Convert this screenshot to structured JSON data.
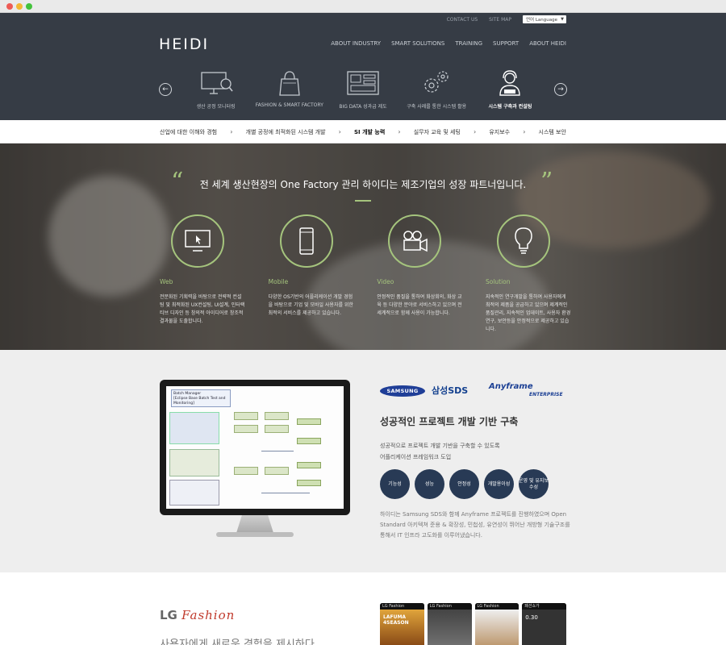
{
  "topbar": {
    "contact": "CONTACT US",
    "sitemap": "SITE MAP",
    "language": "언어 Language"
  },
  "logo": "HEIDI",
  "main_nav": [
    "ABOUT INDUSTRY",
    "SMART SOLUTIONS",
    "TRAINING",
    "SUPPORT",
    "ABOUT HEIDI"
  ],
  "categories": [
    {
      "label": "생산 공정 모니터링",
      "icon": "monitor-magnifier-icon"
    },
    {
      "label": "FASHION & SMART FACTORY",
      "icon": "shopping-bag-icon"
    },
    {
      "label": "BIG DATA 성과급 제도",
      "icon": "dashboard-icon"
    },
    {
      "label": "구축 사례를 통한 시스템 활용",
      "icon": "gears-icon"
    },
    {
      "label": "시스템 구축과 컨설팅",
      "icon": "headset-user-icon"
    }
  ],
  "sub_nav": [
    "산업에 대한 이해와 경험",
    "개별 공정에 최적화된 시스템 개발",
    "SI 개발 능력",
    "실무자 교육 및 세팅",
    "유지보수",
    "시스템 보안"
  ],
  "hero": {
    "quote": "전 세계 생산현장의 One Factory 관리 하이디는 제조기업의 성장 파트너입니다.",
    "open_mark": "“",
    "close_mark": "”",
    "services": [
      {
        "title": "Web",
        "icon": "desktop-cursor-icon",
        "desc": "전문화된 기획력을 바탕으로 전략적 컨설팅 및 최적화된 UX컨설팅, UI설계, 인터랙티브 디자인 등 창의적 아이디어로 창조적 결과물을 도출합니다."
      },
      {
        "title": "Mobile",
        "icon": "smartphone-icon",
        "desc": "다양한 OS기반의 어플리케이션 개발 경험을 바탕으로 기업 및 모바일 사용자를 위한 최적의 서비스를 제공하고 있습니다."
      },
      {
        "title": "Video",
        "icon": "video-camera-icon",
        "desc": "안정적인 품질을 통하여 화상회의, 화상 교육 등 다양한 분야로 서비스하고 있으며 전세계적으로 함께 사용이 가능합니다."
      },
      {
        "title": "Solution",
        "icon": "lightbulb-icon",
        "desc": "지속적인 연구개발을 통하여 사용자에게 최적의 제품을 공급하고 있으며 제계적인 품질관리, 지속적인 업데이트, 사용자 환경 연구, 보안등을 안정적으로 제공하고 있습니다."
      }
    ]
  },
  "samsung": {
    "brand_samsung": "SAMSUNG",
    "brand_sds": "삼성SDS",
    "brand_anyframe": "Anyframe",
    "brand_enterprise": "ENTERPRISE",
    "title": "성공적인 프로젝트 개발 기반 구축",
    "subtitle_line1": "성공적으로 프로젝트 개발 기반을 구축할 수 있도록",
    "subtitle_line2": "어플리케이션 프레임워크 도입",
    "badges": [
      "기능성",
      "성능",
      "안정성",
      "개발용이성",
      "운영 및 유지보수성"
    ],
    "body": "하이디는 Samsung SDS와 함께 Anyframe 프로젝트를 진행하였으며 Open Standard 아키텍쳐 준용 & 확장성, 민첩성, 유연성이 뛰어난 개방형 기술구조를 통해서 IT 인프라 고도화를 이루어냈습니다.",
    "screen_title": "Batch Manager",
    "screen_subtitle": "[Eclipse Base Batch Test and Monitoring]"
  },
  "lg": {
    "brand_lg": "LG",
    "brand_fashion": "Fashion",
    "slogan": "사용자에게 새로운 경험을 제시하다.",
    "phone_labels": [
      "LG Fashion",
      "LG Fashion",
      "LG Fashion",
      "패션쇼가"
    ],
    "promo": "LAFUMA 4SEASON",
    "price": "0.30"
  },
  "colors": {
    "header_bg": "#363c45",
    "accent_green": "#a5c47d",
    "badge_navy": "#283a55",
    "samsung_blue": "#1f3e97"
  }
}
